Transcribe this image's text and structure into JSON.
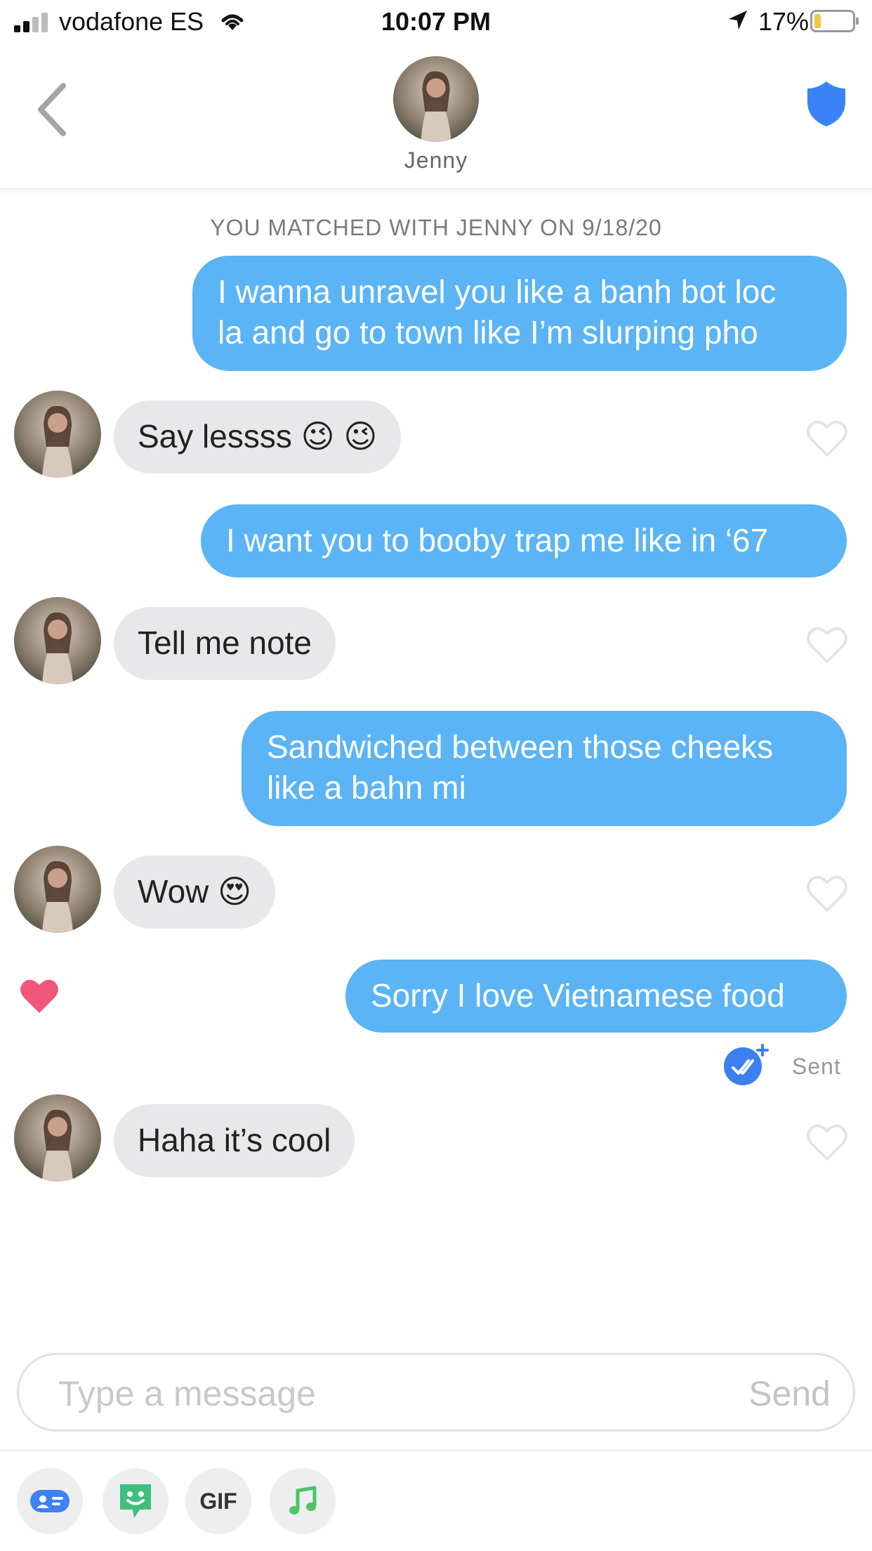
{
  "status_bar": {
    "carrier": "vodafone ES",
    "time": "10:07 PM",
    "battery": "17%",
    "battery_level": 0.17
  },
  "header": {
    "contact_name": "Jenny"
  },
  "conversation": {
    "match_label": "YOU MATCHED WITH JENNY ON 9/18/20",
    "messages": [
      {
        "direction": "out",
        "lines": [
          "I wanna unravel you like a banh bot loc",
          "la and go to town like I’m slurping pho"
        ]
      },
      {
        "direction": "in",
        "text": "Say lessss 😉 😉",
        "liked": false
      },
      {
        "direction": "out",
        "text": "I want you to booby trap me like in ‘67"
      },
      {
        "direction": "in",
        "text": "Tell me note",
        "liked": false
      },
      {
        "direction": "out",
        "lines": [
          "Sandwiched between those cheeks",
          "like a bahn mi"
        ]
      },
      {
        "direction": "in",
        "text": "Wow 😍",
        "liked": false
      },
      {
        "direction": "out",
        "text": "Sorry I love Vietnamese food",
        "liked_by_match": true
      },
      {
        "direction": "in",
        "text": "Haha it’s cool",
        "liked": false
      }
    ],
    "sent_status": "Sent"
  },
  "composer": {
    "placeholder": "Type a message",
    "send_label": "Send"
  },
  "toolbar": {
    "gif_label": "GIF",
    "icons": [
      "contact-card-icon",
      "sticker-icon",
      "gif-icon",
      "music-note-icon"
    ]
  },
  "colors": {
    "outgoing_bubble": "#5ab4f5",
    "incoming_bubble": "#e8e8ea",
    "heart_active": "#f0567a",
    "shield": "#3b82f6",
    "sent_check": "#3b7ff0"
  }
}
